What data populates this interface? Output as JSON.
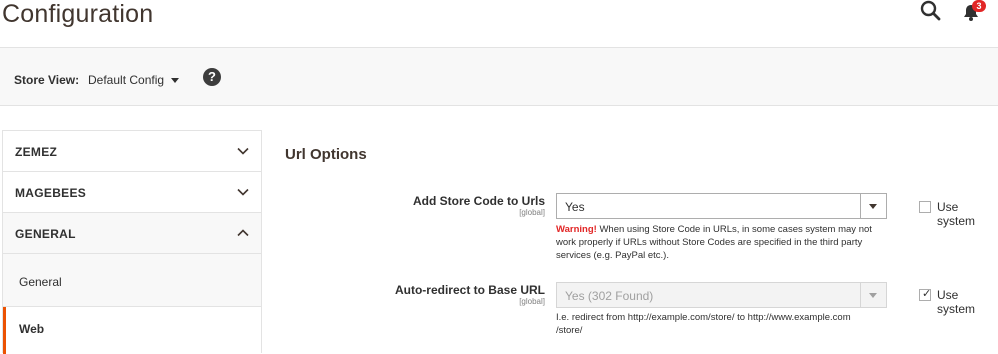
{
  "header": {
    "title": "Configuration",
    "notifications_count": "3"
  },
  "store_view": {
    "label": "Store View:",
    "value": "Default Config"
  },
  "sidebar": {
    "sections": [
      {
        "label": "ZEMEZ",
        "expanded": false
      },
      {
        "label": "MAGEBEES",
        "expanded": false
      },
      {
        "label": "GENERAL",
        "expanded": true
      }
    ],
    "items": [
      {
        "label": "General",
        "active": false
      },
      {
        "label": "Web",
        "active": true
      }
    ]
  },
  "main": {
    "section_title": "Url Options",
    "fields": [
      {
        "label": "Add Store Code to Urls",
        "scope": "[global]",
        "value": "Yes",
        "disabled": false,
        "note_warning": "Warning!",
        "note": " When using Store Code in URLs, in some cases system may not work properly if URLs without Store Codes are specified in the third party services (e.g. PayPal etc.).",
        "use_system_label": "Use system",
        "use_system_checked": false
      },
      {
        "label": "Auto-redirect to Base URL",
        "scope": "[global]",
        "value": "Yes (302 Found)",
        "disabled": true,
        "note": "I.e. redirect from http://example.com/store/ to http://www.example.com /store/",
        "use_system_label": "Use system",
        "use_system_checked": true
      }
    ]
  },
  "colors": {
    "accent": "#eb5202",
    "warning": "#e22626",
    "badge": "#e22626"
  }
}
